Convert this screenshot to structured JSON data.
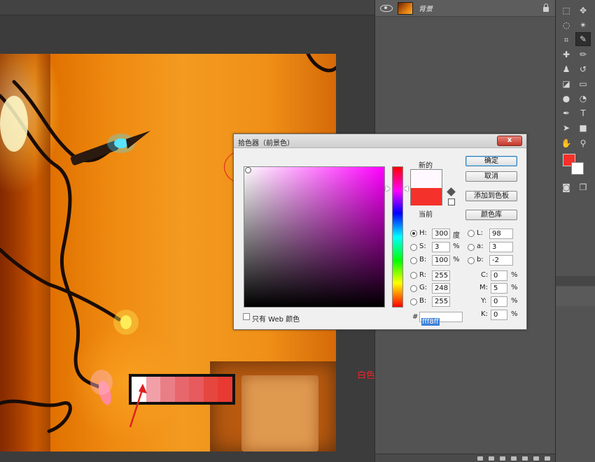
{
  "layers": {
    "items": [
      {
        "name": "背景",
        "visible": true,
        "locked": true
      }
    ]
  },
  "dialog": {
    "title": "拾色器（前景色）",
    "close_label": "x",
    "new_label": "新的",
    "current_label": "当前",
    "new_color": "#fff8ff",
    "current_color": "#f5312b",
    "buttons": {
      "ok": "确定",
      "cancel": "取消",
      "add_to_swatches": "添加到色板",
      "color_libraries": "颜色库"
    },
    "web_only_label": "只有 Web 颜色",
    "hsb": {
      "h_label": "H:",
      "h_value": "300",
      "h_unit": "度",
      "s_label": "S:",
      "s_value": "3",
      "s_unit": "%",
      "b_label": "B:",
      "b_value": "100",
      "b_unit": "%"
    },
    "rgb": {
      "r_label": "R:",
      "r_value": "255",
      "g_label": "G:",
      "g_value": "248",
      "b_label": "B:",
      "b_value": "255"
    },
    "lab": {
      "l_label": "L:",
      "l_value": "98",
      "a_label": "a:",
      "a_value": "3",
      "b_label": "b:",
      "b_value": "-2"
    },
    "cmyk": {
      "c_label": "C:",
      "c_value": "0",
      "c_unit": "%",
      "m_label": "M:",
      "m_value": "5",
      "m_unit": "%",
      "y_label": "Y:",
      "y_value": "0",
      "y_unit": "%",
      "k_label": "K:",
      "k_value": "0",
      "k_unit": "%"
    },
    "hex_label": "#",
    "hex_value": "fff8ff"
  },
  "annotation": {
    "note": "白色的时候已经不是纯白",
    "color": "#e8262c"
  },
  "swatches": [
    "#ffffff",
    "#f1a0a8",
    "#ea7e86",
    "#e8676c",
    "#e75a5d",
    "#e5473e",
    "#e83a33"
  ],
  "tools": {
    "foreground_color": "#f5312b",
    "background_color": "#ffffff"
  }
}
